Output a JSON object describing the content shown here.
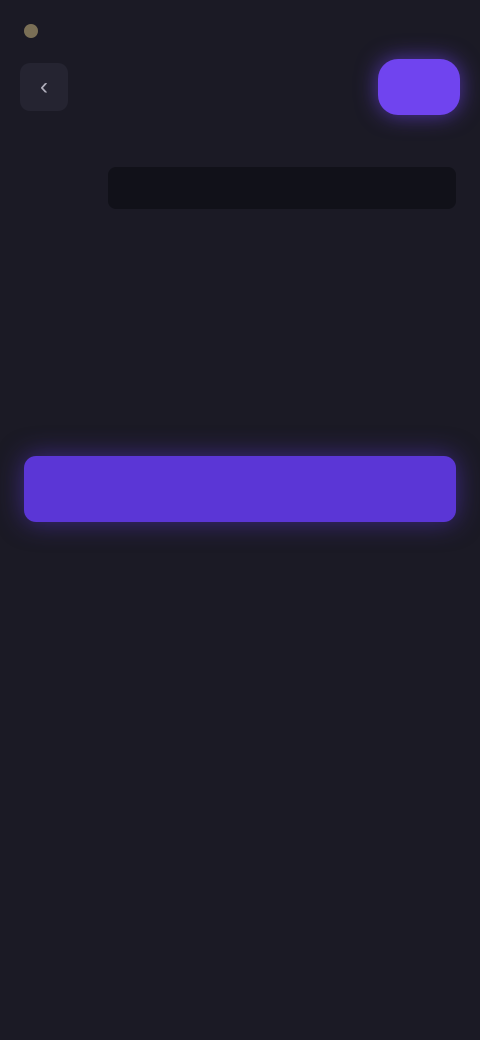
{
  "status": {
    "time": "",
    "battery": ""
  },
  "header": {
    "back_label": "",
    "title": "",
    "action_label": ""
  },
  "content": {
    "paragraph_1": "",
    "paragraph_2": "",
    "section_label": "",
    "field_prefix": "",
    "field_value": "",
    "field_placeholder": "",
    "hint": ""
  },
  "actions": {
    "primary_label": "",
    "secondary_label": ""
  },
  "colors": {
    "background": "#1b1a25",
    "accent": "#7044ef",
    "primary_button": "#5b36d6"
  }
}
